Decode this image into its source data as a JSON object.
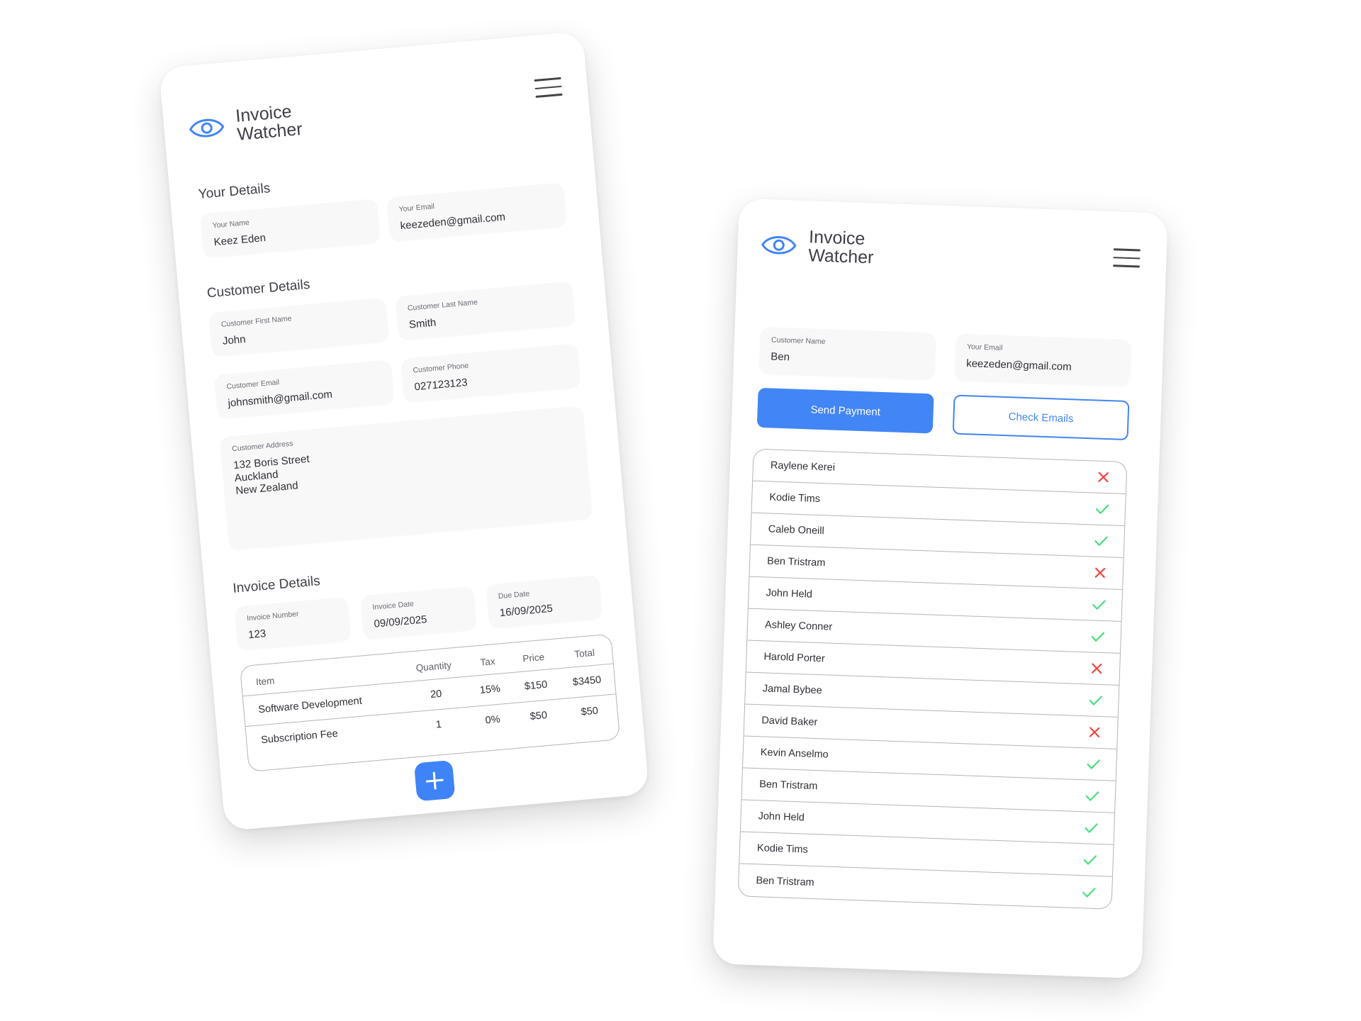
{
  "app_name": "Invoice\nWatcher",
  "colors": {
    "accent": "#4285f4",
    "success": "#4ade80",
    "error": "#ef4444"
  },
  "invoice_form": {
    "your_details": {
      "title": "Your Details",
      "name": {
        "label": "Your Name",
        "value": "Keez Eden"
      },
      "email": {
        "label": "Your Email",
        "value": "keezeden@gmail.com"
      }
    },
    "customer_details": {
      "title": "Customer Details",
      "first_name": {
        "label": "Customer First Name",
        "value": "John"
      },
      "last_name": {
        "label": "Customer Last Name",
        "value": "Smith"
      },
      "email": {
        "label": "Customer Email",
        "value": "johnsmith@gmail.com"
      },
      "phone": {
        "label": "Customer Phone",
        "value": "027123123"
      },
      "address": {
        "label": "Customer Address",
        "value": "132 Boris Street\nAuckland\nNew Zealand"
      }
    },
    "invoice_details": {
      "title": "Invoice Details",
      "number": {
        "label": "Invoice Number",
        "value": "123"
      },
      "date": {
        "label": "Invoice Date",
        "value": "09/09/2025"
      },
      "due": {
        "label": "Due Date",
        "value": "16/09/2025"
      }
    },
    "items_table": {
      "headers": [
        "Item",
        "Quantity",
        "Tax",
        "Price",
        "Total"
      ],
      "rows": [
        [
          "Software Development",
          "20",
          "15%",
          "$150",
          "$3450"
        ],
        [
          "Subscription Fee",
          "1",
          "0%",
          "$50",
          "$50"
        ]
      ]
    },
    "add_icon": "plus-icon"
  },
  "payment_panel": {
    "customer_name": {
      "label": "Customer Name",
      "value": "Ben"
    },
    "email": {
      "label": "Your Email",
      "value": "keezeden@gmail.com"
    },
    "send_payment_label": "Send Payment",
    "check_emails_label": "Check Emails",
    "customers": [
      {
        "name": "Raylene Kerei",
        "status": "failed"
      },
      {
        "name": "Kodie Tims",
        "status": "ok"
      },
      {
        "name": "Caleb Oneill",
        "status": "ok"
      },
      {
        "name": "Ben Tristram",
        "status": "failed"
      },
      {
        "name": "John Held",
        "status": "ok"
      },
      {
        "name": "Ashley Conner",
        "status": "ok"
      },
      {
        "name": "Harold Porter",
        "status": "failed"
      },
      {
        "name": "Jamal Bybee",
        "status": "ok"
      },
      {
        "name": "David Baker",
        "status": "failed"
      },
      {
        "name": "Kevin Anselmo",
        "status": "ok"
      },
      {
        "name": "Ben Tristram",
        "status": "ok"
      },
      {
        "name": "John Held",
        "status": "ok"
      },
      {
        "name": "Kodie Tims",
        "status": "ok"
      },
      {
        "name": "Ben Tristram",
        "status": "ok"
      }
    ]
  }
}
